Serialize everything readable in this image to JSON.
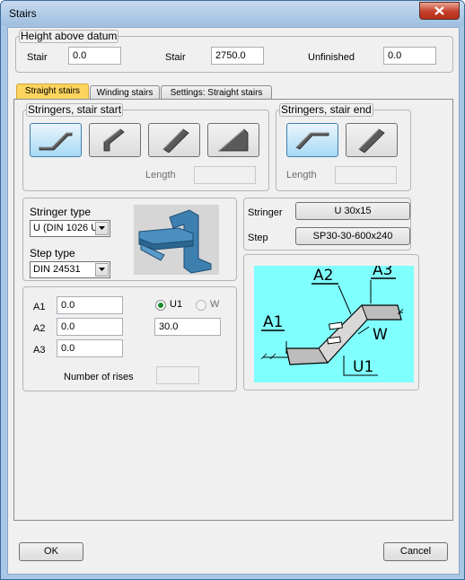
{
  "window": {
    "title": "Stairs"
  },
  "height_group": {
    "label": "Height above datum",
    "stair_label_1": "Stair",
    "stair_value_1": "0.0",
    "stair_label_2": "Stair",
    "stair_value_2": "2750.0",
    "unfinished_label": "Unfinished",
    "unfinished_value": "0.0"
  },
  "tabs": [
    {
      "label": "Straight stairs",
      "active": true
    },
    {
      "label": "Winding stairs",
      "active": false
    },
    {
      "label": "Settings: Straight stairs",
      "active": false
    }
  ],
  "stringer_start": {
    "label": "Stringers, stair start",
    "length_label": "Length",
    "length_value": ""
  },
  "stringer_end": {
    "label": "Stringers, stair end",
    "length_label": "Length",
    "length_value": ""
  },
  "types": {
    "stringer_type_label": "Stringer type",
    "stringer_type_value": "U (DIN 1026 U",
    "step_type_label": "Step type",
    "step_type_value": "DIN 24531"
  },
  "selection": {
    "stringer_label": "Stringer",
    "stringer_value": "U 30x15",
    "step_label": "Step",
    "step_value": "SP30-30-600x240"
  },
  "dimensions": {
    "a1_label": "A1",
    "a1_value": "0.0",
    "a2_label": "A2",
    "a2_value": "0.0",
    "a3_label": "A3",
    "a3_value": "0.0",
    "u1_label": "U1",
    "w_label": "W",
    "u1_value": "30.0",
    "rises_label": "Number of rises",
    "rises_value": ""
  },
  "diagram": {
    "a1": "A1",
    "a2": "A2",
    "a3": "A3",
    "w": "W",
    "u1": "U1",
    "bg": "#80ffff"
  },
  "footer": {
    "ok_label": "OK",
    "cancel_label": "Cancel"
  },
  "colors": {
    "accent_tab": "#fcd45e",
    "selected_button": "#a7d9f5",
    "radio_dot": "#1a8a2e"
  }
}
